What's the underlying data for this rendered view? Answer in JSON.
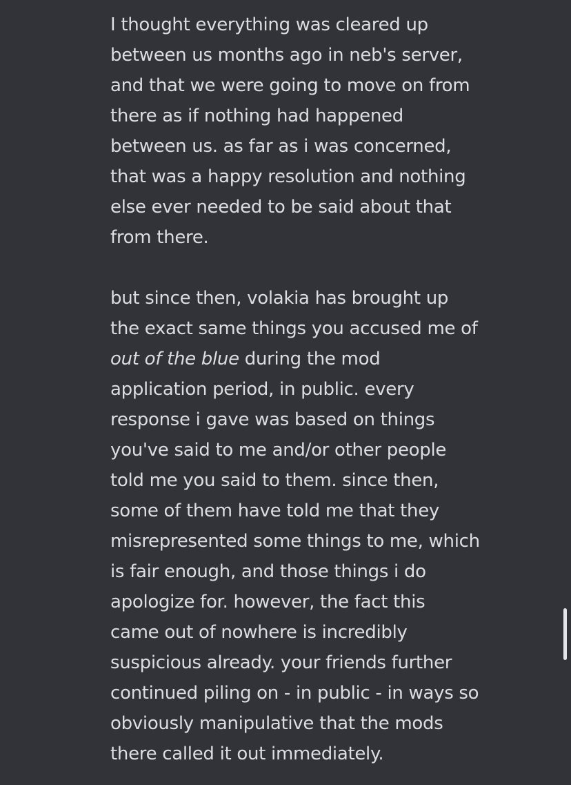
{
  "message": {
    "paragraph_1": [
      "I thought everything was cleared up",
      "between us months ago in neb's server,",
      "and that we were going to move on from",
      "there as if nothing had happened",
      "between us. as far as i was concerned,",
      "that was a happy resolution and nothing",
      "else ever needed to be said about that",
      "from there."
    ],
    "paragraph_2": {
      "line_1": "but since then, volakia has brought up",
      "line_2": "the exact same things you accused me of",
      "line_3_italic": "out of the blue",
      "line_3_rest": " during the mod",
      "lines_rest": [
        "application period, in public. every",
        "response i gave was based on things",
        "you've said to me and/or other people",
        "told me you said to them. since then,",
        "some of them have told me that they",
        "misrepresented some things to me, which",
        "is fair enough, and those things i do",
        "apologize for. however, the fact this",
        "came out of nowhere is incredibly",
        "suspicious already. your friends further",
        "continued piling on - in public - in ways so",
        "obviously manipulative that the mods",
        "there called it out immediately."
      ]
    }
  },
  "scrollbar": {
    "position_fraction": 0.83
  }
}
